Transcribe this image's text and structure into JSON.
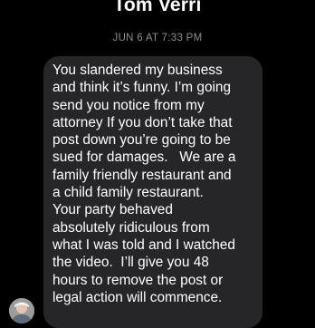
{
  "conversation": {
    "contact_name": "Tom Verri",
    "timestamp": "JUN 6 AT 7:33 PM"
  },
  "message": {
    "sender": "incoming",
    "lines": [
      "You slandered my business",
      "and think it’s funny. I’m going",
      "send you notice from my",
      "attorney If you don’t take that",
      "post down you’re going to be",
      "sued for damages.   We are a",
      "family friendly restaurant and",
      "a child family restaurant.",
      "Your party behaved",
      "absolutely ridiculous from",
      "what I was told and I watched",
      "the video.  I’ll give you 48",
      "hours to remove the post or",
      "legal action will commence."
    ]
  },
  "avatar": {
    "icon": "contact-photo"
  },
  "colors": {
    "background": "#000000",
    "bubble": "#262628",
    "timestamp": "#8e8e93",
    "text": "#ffffff"
  }
}
